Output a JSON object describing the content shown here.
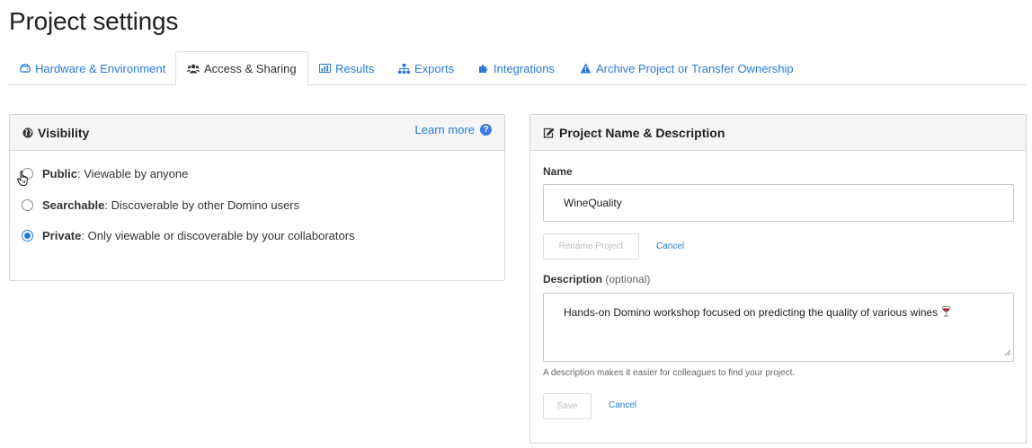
{
  "page": {
    "title": "Project settings"
  },
  "tabs": [
    {
      "label": "Hardware & Environment",
      "icon": "hdd-icon",
      "active": false
    },
    {
      "label": "Access & Sharing",
      "icon": "users-icon",
      "active": true
    },
    {
      "label": "Results",
      "icon": "bar-chart-icon",
      "active": false
    },
    {
      "label": "Exports",
      "icon": "sitemap-icon",
      "active": false
    },
    {
      "label": "Integrations",
      "icon": "puzzle-icon",
      "active": false
    },
    {
      "label": "Archive Project or Transfer Ownership",
      "icon": "warning-icon",
      "active": false
    }
  ],
  "visibility": {
    "title": "Visibility",
    "learn_more": "Learn more",
    "help_glyph": "?",
    "options": [
      {
        "name": "Public",
        "desc": ": Viewable by anyone",
        "checked": false
      },
      {
        "name": "Searchable",
        "desc": ": Discoverable by other Domino users",
        "checked": false
      },
      {
        "name": "Private",
        "desc": ": Only viewable or discoverable by your collaborators",
        "checked": true
      }
    ]
  },
  "project": {
    "title": "Project Name & Description",
    "name_label": "Name",
    "name_value": "WineQuality",
    "rename_label": "Rename Project",
    "cancel_label": "Cancel",
    "description_label": "Description",
    "description_optional": "(optional)",
    "description_value": "Hands-on Domino workshop focused on predicting the quality of various wines",
    "description_hint": "A description makes it easier for colleagues to find your project.",
    "save_label": "Save",
    "cancel2_label": "Cancel"
  },
  "colors": {
    "link": "#2a7ad6",
    "panel_header": "#f5f5f5",
    "border": "#d6d6d6"
  }
}
